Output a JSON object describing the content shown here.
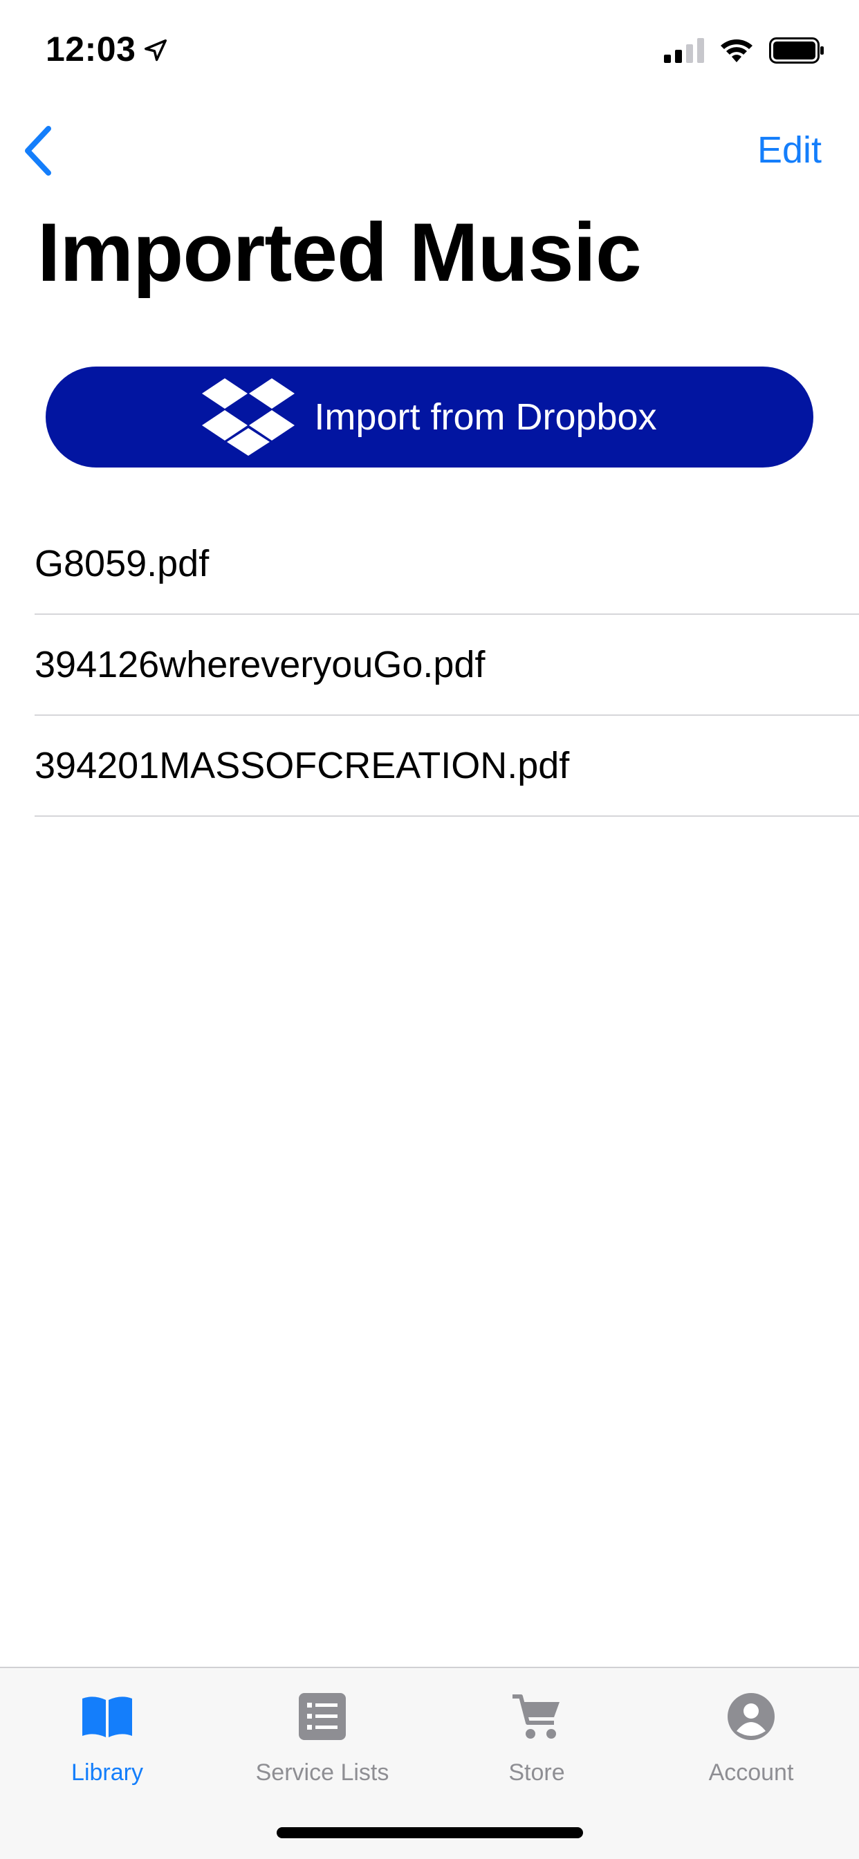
{
  "status_bar": {
    "time": "12:03",
    "icons": [
      "location-arrow-icon",
      "cellular-signal-icon",
      "wifi-icon",
      "battery-icon"
    ]
  },
  "nav": {
    "back_icon": "chevron-left-icon",
    "edit_label": "Edit"
  },
  "page": {
    "title": "Imported Music"
  },
  "dropbox_button": {
    "label": "Import from Dropbox",
    "icon": "dropbox-icon",
    "color": "#0215a1"
  },
  "files": [
    {
      "name": "G8059.pdf"
    },
    {
      "name": "394126whereveryouGo.pdf"
    },
    {
      "name": "394201MASSOFCREATION.pdf"
    }
  ],
  "tab_bar": {
    "active_color": "#147efb",
    "inactive_color": "#8e8e93",
    "tabs": [
      {
        "label": "Library",
        "icon": "book-icon",
        "active": true
      },
      {
        "label": "Service Lists",
        "icon": "list-icon",
        "active": false
      },
      {
        "label": "Store",
        "icon": "cart-icon",
        "active": false
      },
      {
        "label": "Account",
        "icon": "account-icon",
        "active": false
      }
    ]
  }
}
